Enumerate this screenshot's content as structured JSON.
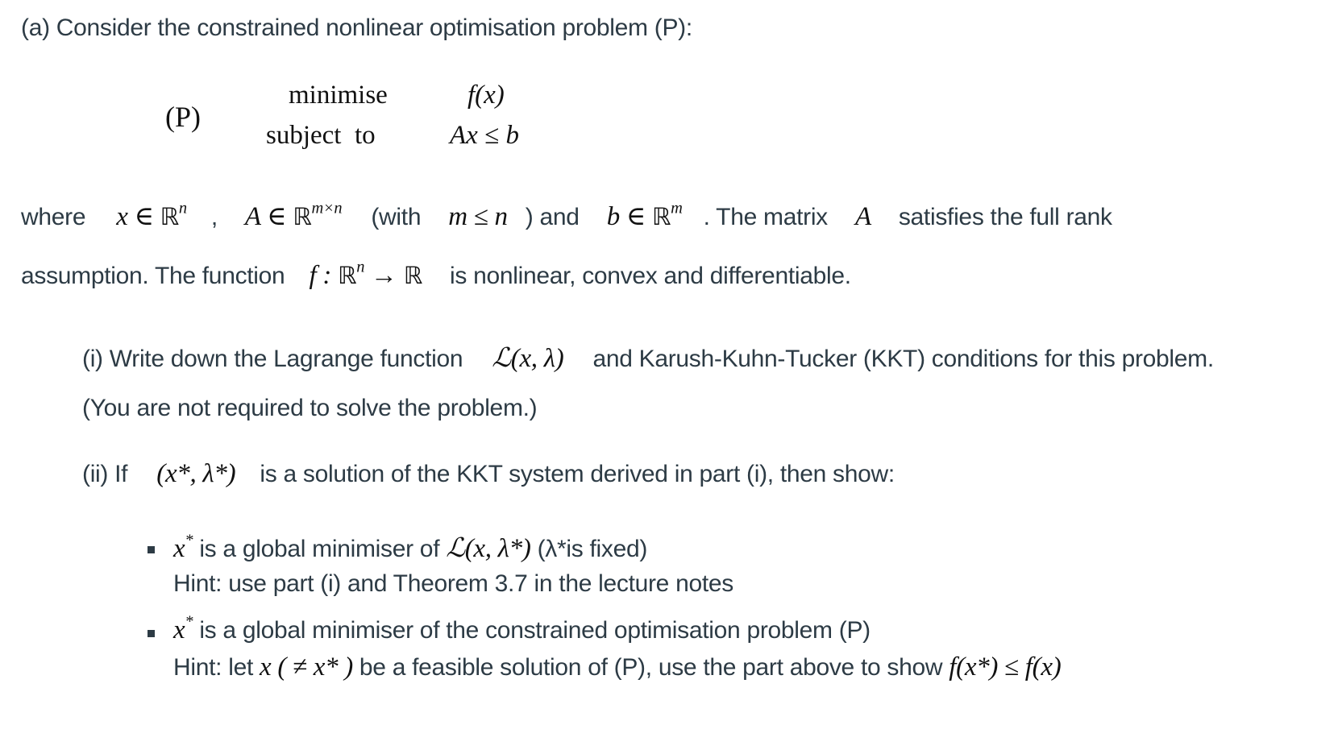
{
  "intro": "(a) Consider the constrained nonlinear optimisation problem (P):",
  "problem": {
    "label": "(P)",
    "row1_keyword": "minimise",
    "row1_expr": "f(x)",
    "row2_keyword": "subject  to",
    "row2_expr_A": "Ax",
    "row2_expr_leq": "≤",
    "row2_expr_b": "b"
  },
  "where_line": {
    "where": "where",
    "x_in": "x ∈ ",
    "Rn": "ℝ",
    "n_sup": "n",
    "comma": ",",
    "A_in": "A ∈ ",
    "Rmn": "ℝ",
    "mn_sup": "m×n",
    "with": "(with",
    "m_leq_n": "m ≤ n",
    "and": ") and",
    "b_in": "b ∈ ",
    "Rm": "ℝ",
    "m_sup": "m",
    "the_matrix": ". The matrix",
    "A": "A",
    "full_rank": "satisfies the full rank"
  },
  "assumption_line": {
    "prefix": "assumption. The function",
    "f_map": "f : ",
    "R1": "ℝ",
    "n_sup": "n",
    "arrow": " → ",
    "R2": "ℝ",
    "suffix": "is nonlinear, convex and differentiable."
  },
  "part_i": {
    "prefix": "(i) Write down the Lagrange function",
    "lagrangian": "(x, λ)",
    "L": "ℒ",
    "suffix": "and Karush-Kuhn-Tucker (KKT) conditions for this problem.",
    "note": "(You are not required to solve the problem.)"
  },
  "part_ii": {
    "prefix": "(ii) If",
    "pair": "(x*, λ*)",
    "suffix": "is a solution of the KKT system derived in part (i), then show:",
    "bullets": [
      {
        "x": "x",
        "star": "*",
        "text": " is a global minimiser of ",
        "L": "ℒ",
        "expr": "(x, λ*)",
        "tail": " (λ*is fixed)",
        "hint": "Hint: use part (i) and Theorem 3.7 in the lecture notes"
      },
      {
        "x": "x",
        "star": "*",
        "text": " is a global minimiser of the constrained optimisation problem (P)",
        "hint_prefix": "Hint: let ",
        "hint_x": "x",
        "hint_paren": " ( ≠ x* ) ",
        "hint_mid": "be a feasible solution of (P), use the part above to show ",
        "hint_expr": "f(x*) ≤ f(x)"
      }
    ]
  }
}
